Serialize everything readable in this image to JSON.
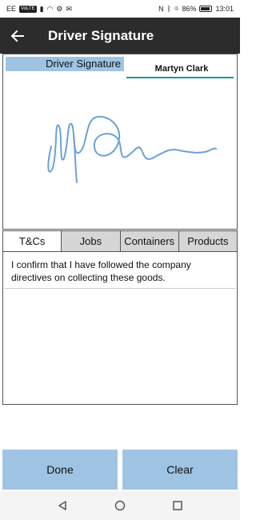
{
  "status_bar": {
    "carrier": "EE",
    "chip": "VoLTE",
    "battery": "86%",
    "time": "13:01"
  },
  "app_bar": {
    "title": "Driver Signature"
  },
  "signature": {
    "label": "Driver Signature",
    "signer_name": "Martyn Clark"
  },
  "tabs": [
    {
      "label": "T&Cs"
    },
    {
      "label": "Jobs"
    },
    {
      "label": "Containers"
    },
    {
      "label": "Products"
    }
  ],
  "tnc": {
    "text": "I confirm that I have followed the company directives on collecting these goods."
  },
  "buttons": {
    "done": "Done",
    "clear": "Clear"
  },
  "colors": {
    "app_bar": "#2c2c2c",
    "accent_blue": "#9fc3e3",
    "signature_ink": "#6aa2d9",
    "underline": "#1a9a8a"
  }
}
